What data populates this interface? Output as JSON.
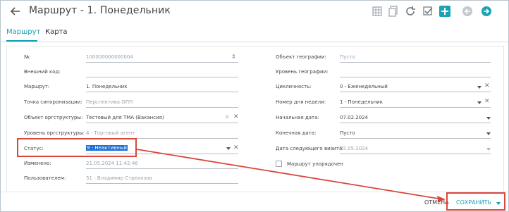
{
  "header": {
    "title": "Маршрут - 1. Понедельник",
    "icons": [
      "back-arrow-icon",
      "columns-icon",
      "copy-icon",
      "refresh-icon",
      "check-icon",
      "add-icon",
      "prev-icon",
      "next-icon"
    ]
  },
  "tabs": [
    {
      "label": "Маршрут",
      "active": true
    },
    {
      "label": "Карта",
      "active": false
    }
  ],
  "form": {
    "left": {
      "number": {
        "label": "№:",
        "value": "100000000000004"
      },
      "external_code": {
        "label": "Внешний код:",
        "value": ""
      },
      "route": {
        "label": "Маршрут:",
        "value": "1. Понедельник"
      },
      "sync_point": {
        "label": "Точка синхронизации:",
        "value": "Перспектива ОПП"
      },
      "org_object": {
        "label": "Объект оргструктуры:",
        "value": "Тестовый для ТМА (Вакансия)"
      },
      "org_level": {
        "label": "Уровень оргструктуры:",
        "value": "4 - Торговый агент"
      },
      "status": {
        "label": "Статус:",
        "value": "9 - Неактивный"
      },
      "changed": {
        "label": "Изменено:",
        "value": "21.05.2024 11:42:46"
      },
      "user": {
        "label": "Пользователем:",
        "value": "51 - Владимир Стрекозов"
      }
    },
    "right": {
      "geo_object": {
        "label": "Объект географии:",
        "placeholder": "Пусто"
      },
      "geo_level": {
        "label": "Уровень географии:",
        "value": ""
      },
      "cyclicity": {
        "label": "Цикличность:",
        "value": "0 - Еженедельный"
      },
      "week_day": {
        "label": "Номер дня недели:",
        "value": "1 - Понедельник"
      },
      "start_date": {
        "label": "Начальная дата:",
        "value": "07.02.2024"
      },
      "end_date": {
        "label": "Конечная дата:",
        "value": "Пусто"
      },
      "next_visit": {
        "label": "Дата следующего визита:",
        "value": "27.05.2024"
      },
      "ordered": {
        "label": "Маршрут упорядочен",
        "checked": false
      }
    }
  },
  "footer": {
    "cancel_label": "ОТМЕНА",
    "save_label": "СОХРАНИТЬ"
  },
  "colors": {
    "accent": "#1a9fb6",
    "annotation": "#d9473b",
    "selection": "#1c6fd4"
  }
}
